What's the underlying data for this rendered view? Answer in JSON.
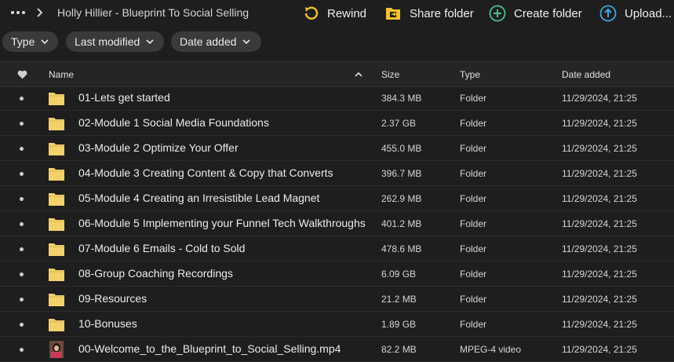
{
  "breadcrumb": {
    "title": "Holly Hillier - Blueprint To Social Selling"
  },
  "toolbar": {
    "rewind_label": "Rewind",
    "share_label": "Share folder",
    "create_label": "Create folder",
    "upload_label": "Upload...",
    "colors": {
      "rewind": "#f2c230",
      "share": "#f2c230",
      "create": "#4cc08a",
      "upload": "#3ea6e0"
    }
  },
  "filters": {
    "type_label": "Type",
    "modified_label": "Last modified",
    "date_added_label": "Date added"
  },
  "table": {
    "headers": {
      "name": "Name",
      "size": "Size",
      "type": "Type",
      "date_added": "Date added"
    },
    "sort_icon": "chevron-up-icon",
    "folder_color": "#f2d16b",
    "rows": [
      {
        "name": "01-Lets get started",
        "size": "384.3 MB",
        "type": "Folder",
        "date": "11/29/2024, 21:25",
        "icon": "folder-icon"
      },
      {
        "name": "02-Module 1 Social Media Foundations",
        "size": "2.37 GB",
        "type": "Folder",
        "date": "11/29/2024, 21:25",
        "icon": "folder-icon"
      },
      {
        "name": "03-Module 2 Optimize Your Offer",
        "size": "455.0 MB",
        "type": "Folder",
        "date": "11/29/2024, 21:25",
        "icon": "folder-icon"
      },
      {
        "name": "04-Module 3 Creating Content & Copy that Converts",
        "size": "396.7 MB",
        "type": "Folder",
        "date": "11/29/2024, 21:25",
        "icon": "folder-icon"
      },
      {
        "name": "05-Module 4 Creating an Irresistible Lead Magnet",
        "size": "262.9 MB",
        "type": "Folder",
        "date": "11/29/2024, 21:25",
        "icon": "folder-icon"
      },
      {
        "name": "06-Module 5 Implementing your Funnel Tech Walkthroughs",
        "size": "401.2 MB",
        "type": "Folder",
        "date": "11/29/2024, 21:25",
        "icon": "folder-icon"
      },
      {
        "name": "07-Module 6 Emails - Cold to Sold",
        "size": "478.6 MB",
        "type": "Folder",
        "date": "11/29/2024, 21:25",
        "icon": "folder-icon"
      },
      {
        "name": "08-Group Coaching Recordings",
        "size": "6.09 GB",
        "type": "Folder",
        "date": "11/29/2024, 21:25",
        "icon": "folder-icon"
      },
      {
        "name": "09-Resources",
        "size": "21.2 MB",
        "type": "Folder",
        "date": "11/29/2024, 21:25",
        "icon": "folder-icon"
      },
      {
        "name": "10-Bonuses",
        "size": "1.89 GB",
        "type": "Folder",
        "date": "11/29/2024, 21:25",
        "icon": "folder-icon"
      },
      {
        "name": "00-Welcome_to_the_Blueprint_to_Social_Selling.mp4",
        "size": "82.2 MB",
        "type": "MPEG-4 video",
        "date": "11/29/2024, 21:25",
        "icon": "video-thumbnail"
      }
    ]
  }
}
